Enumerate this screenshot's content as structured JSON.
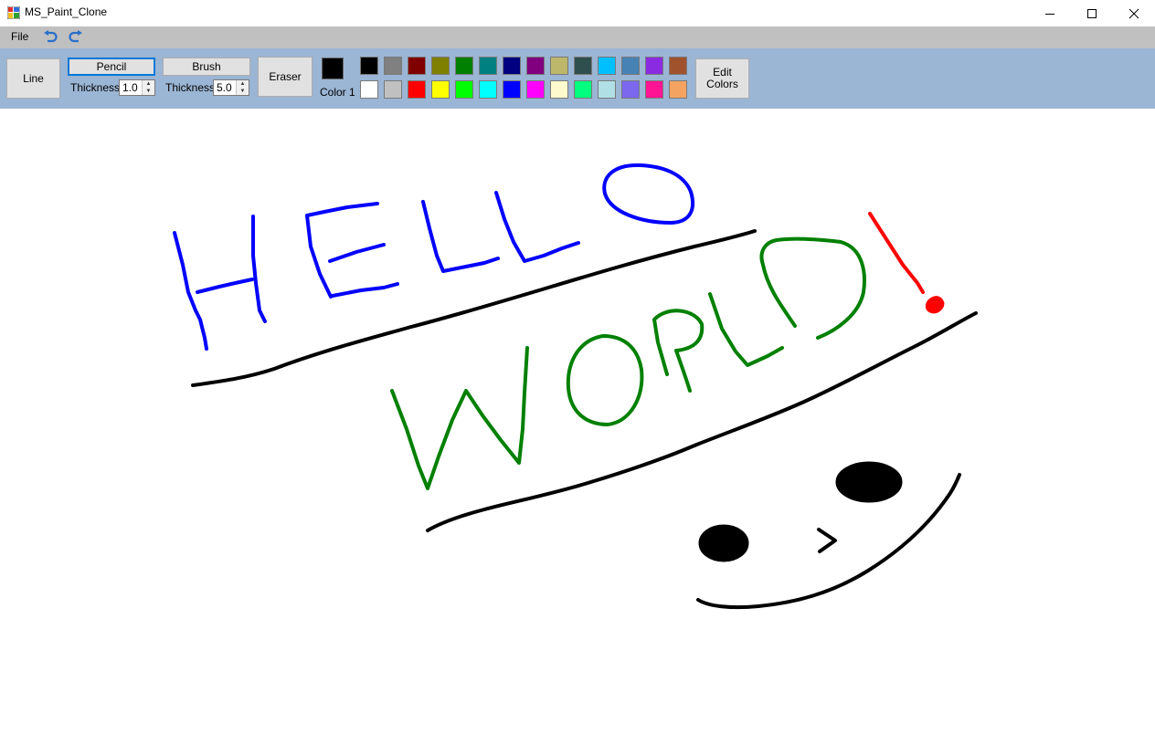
{
  "window": {
    "title": "MS_Paint_Clone"
  },
  "menu": {
    "file_label": "File"
  },
  "toolbar": {
    "line_label": "Line",
    "pencil_label": "Pencil",
    "pencil_thickness_label": "Thickness",
    "pencil_thickness_value": "1.0",
    "brush_label": "Brush",
    "brush_thickness_label": "Thickness",
    "brush_thickness_value": "5.0",
    "eraser_label": "Eraser",
    "color1_label": "Color 1",
    "color1_value": "#000000",
    "edit_colors_label": "Edit\nColors"
  },
  "palette": {
    "row1": [
      "#000000",
      "#808080",
      "#800000",
      "#808000",
      "#008000",
      "#008080",
      "#000080",
      "#800080",
      "#BDB76B",
      "#2F4F4F",
      "#00BFFF",
      "#4682B4",
      "#8A2BE2",
      "#A0522D"
    ],
    "row2": [
      "#FFFFFF",
      "#C0C0C0",
      "#FF0000",
      "#FFFF00",
      "#00FF00",
      "#00FFFF",
      "#0000FF",
      "#FF00FF",
      "#FFFACD",
      "#00FF7F",
      "#B0E0E6",
      "#7B68EE",
      "#FF1493",
      "#F4A460"
    ]
  },
  "drawing_colors": {
    "blue": "#0000ff",
    "green": "#008000",
    "red": "#ff0000",
    "black": "#000000"
  }
}
